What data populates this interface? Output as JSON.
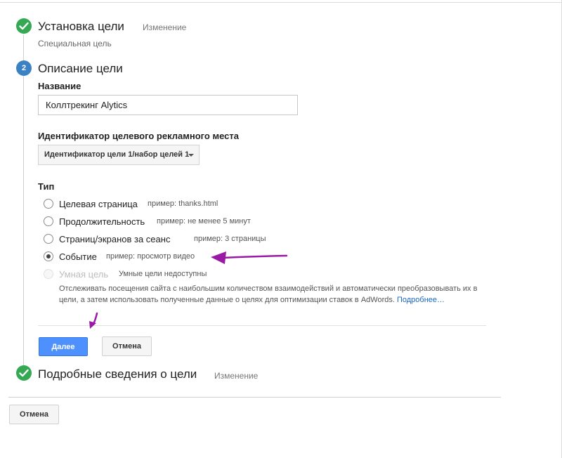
{
  "steps": {
    "goal_setup": {
      "title": "Установка цели",
      "edit_link": "Изменение",
      "subtitle": "Специальная цель"
    },
    "goal_description": {
      "number": "2",
      "title": "Описание цели",
      "name_label": "Название",
      "name_value": "Коллтрекинг Alytics",
      "slot_label": "Идентификатор целевого рекламного места",
      "slot_value": "Идентификатор цели 1/набор целей 1",
      "type_label": "Тип",
      "options": [
        {
          "label": "Целевая страница",
          "example": "пример: thanks.html",
          "checked": false,
          "disabled": false
        },
        {
          "label": "Продолжительность",
          "example": "пример: не менее 5 минут",
          "checked": false,
          "disabled": false
        },
        {
          "label": "Страниц/экранов за сеанс",
          "example": "пример: 3 страницы",
          "checked": false,
          "disabled": false
        },
        {
          "label": "Событие",
          "example": "пример: просмотр видео",
          "checked": true,
          "disabled": false
        },
        {
          "label": "Умная цель",
          "example": "Умные цели недоступны",
          "checked": false,
          "disabled": true
        }
      ],
      "smart_description": "Отслеживать посещения сайта с наибольшим количеством взаимодействий и автоматически преобразовывать их в цели, а затем использовать полученные данные о целях для оптимизации ставок в AdWords.",
      "more_link": "Подробнее…",
      "next_button": "Далее",
      "cancel_button": "Отмена"
    },
    "goal_details": {
      "title": "Подробные сведения о цели",
      "edit_link": "Изменение"
    }
  },
  "footer": {
    "cancel_button": "Отмена"
  },
  "colors": {
    "check_green": "#34a853",
    "step_blue": "#3b82c4",
    "primary_button": "#4d90fe",
    "annotation_arrow": "#9b1aa5",
    "link": "#1a66c2"
  }
}
